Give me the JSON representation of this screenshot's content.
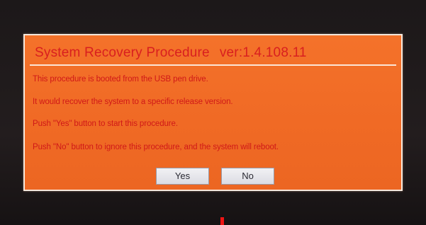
{
  "dialog": {
    "title": "System Recovery Procedure",
    "version": "ver:1.4.108.11",
    "messages": [
      "This procedure is booted from the USB pen drive.",
      "It would recover the system to a specific release version.",
      "Push \"Yes\" button to start this procedure.",
      "Push \"No\" button to ignore this procedure, and the system will reboot."
    ],
    "yes_label": "Yes",
    "no_label": "No"
  },
  "colors": {
    "dialog_background": "#f06a25",
    "text": "#d01818",
    "border": "#f6e8dc",
    "screen_background": "#1e1a1b",
    "cursor_mark": "#f01414"
  }
}
